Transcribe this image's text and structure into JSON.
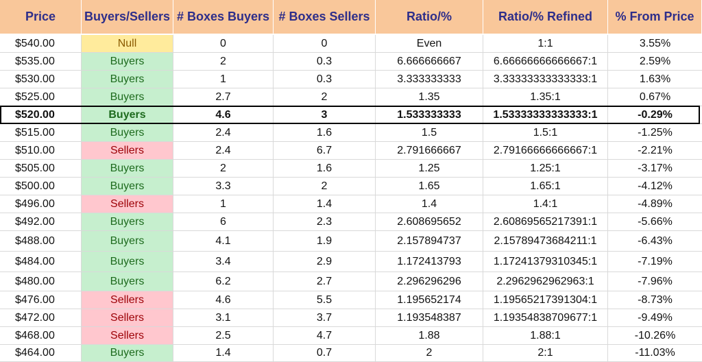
{
  "table": {
    "columns": [
      "Price",
      "Buyers/Sellers",
      "# Boxes Buyers",
      "# Boxes Sellers",
      "Ratio/%",
      "Ratio/% Refined",
      "% From Price"
    ],
    "current_price": "$520.00",
    "rows": [
      [
        "$540.00",
        "Null",
        "0",
        "0",
        "Even",
        "1:1",
        "3.55%"
      ],
      [
        "$535.00",
        "Buyers",
        "2",
        "0.3",
        "6.666666667",
        "6.66666666666667:1",
        "2.59%"
      ],
      [
        "$530.00",
        "Buyers",
        "1",
        "0.3",
        "3.333333333",
        "3.33333333333333:1",
        "1.63%"
      ],
      [
        "$525.00",
        "Buyers",
        "2.7",
        "2",
        "1.35",
        "1.35:1",
        "0.67%"
      ],
      [
        "$520.00",
        "Buyers",
        "4.6",
        "3",
        "1.533333333",
        "1.53333333333333:1",
        "-0.29%"
      ],
      [
        "$515.00",
        "Buyers",
        "2.4",
        "1.6",
        "1.5",
        "1.5:1",
        "-1.25%"
      ],
      [
        "$510.00",
        "Sellers",
        "2.4",
        "6.7",
        "2.791666667",
        "2.79166666666667:1",
        "-2.21%"
      ],
      [
        "$505.00",
        "Buyers",
        "2",
        "1.6",
        "1.25",
        "1.25:1",
        "-3.17%"
      ],
      [
        "$500.00",
        "Buyers",
        "3.3",
        "2",
        "1.65",
        "1.65:1",
        "-4.12%"
      ],
      [
        "$496.00",
        "Sellers",
        "1",
        "1.4",
        "1.4",
        "1.4:1",
        "-4.89%"
      ],
      [
        "$492.00",
        "Buyers",
        "6",
        "2.3",
        "2.608695652",
        "2.60869565217391:1",
        "-5.66%"
      ],
      [
        "$488.00",
        "Buyers",
        "4.1",
        "1.9",
        "2.157894737",
        "2.15789473684211:1",
        "-6.43%"
      ],
      [
        "$484.00",
        "Buyers",
        "3.4",
        "2.9",
        "1.172413793",
        "1.17241379310345:1",
        "-7.19%"
      ],
      [
        "$480.00",
        "Buyers",
        "6.2",
        "2.7",
        "2.296296296",
        "2.2962962962963:1",
        "-7.96%"
      ],
      [
        "$476.00",
        "Sellers",
        "4.6",
        "5.5",
        "1.195652174",
        "1.19565217391304:1",
        "-8.73%"
      ],
      [
        "$472.00",
        "Sellers",
        "3.1",
        "3.7",
        "1.193548387",
        "1.19354838709677:1",
        "-9.49%"
      ],
      [
        "$468.00",
        "Sellers",
        "2.5",
        "4.7",
        "1.88",
        "1.88:1",
        "-10.26%"
      ],
      [
        "$464.00",
        "Buyers",
        "1.4",
        "0.7",
        "2",
        "2:1",
        "-11.03%"
      ]
    ]
  },
  "colors": {
    "header_bg": "#f9c79a",
    "header_text": "#2e2e8a",
    "buyers_bg": "#c6efce",
    "buyers_text": "#1e6b1e",
    "sellers_bg": "#ffc7ce",
    "sellers_text": "#9c0006",
    "null_bg": "#ffeb9c",
    "null_text": "#8a5a00"
  }
}
